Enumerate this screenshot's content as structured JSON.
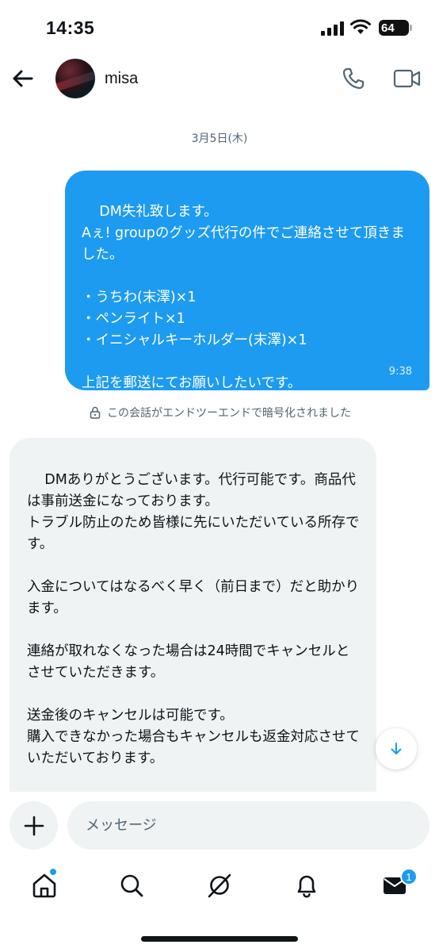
{
  "status_bar": {
    "time": "14:35",
    "battery": "64"
  },
  "header": {
    "contact_name": "misa",
    "icons": [
      "back-arrow-icon",
      "avatar",
      "phone-icon",
      "video-camera-icon"
    ]
  },
  "chat": {
    "date_separator": "3月5日(木)",
    "messages": [
      {
        "direction": "outgoing",
        "text": "DM失礼致します。\nAぇ! groupのグッズ代行の件でご連絡させて頂きました。\n\n・うちわ(末澤)×1\n・ペンライト×1\n・イニシャルキーホルダー(末澤)×1\n\n上記を郵送にてお願いしたいです。",
        "time": "9:38"
      },
      {
        "direction": "incoming",
        "text": "DMありがとうございます。代行可能です。商品代は事前送金になっております。\nトラブル防止のため皆様に先にいただいている所存です。\n\n入金についてはなるべく早く（前日まで）だと助かります。\n\n連絡が取れなくなった場合は24時間でキャンセルとさせていただきます。\n\n送金後のキャンセルは可能です。\n購入できなかった場合もキャンセルも返金対応させていただいております。\n\n長文になりましたがよろしくお願いします"
      }
    ],
    "encryption_note": "この会話がエンドツーエンドで暗号化されました"
  },
  "composer": {
    "placeholder": "メッセージ"
  },
  "bottom_nav": {
    "items": [
      "home-icon",
      "search-icon",
      "grok-icon",
      "notifications-bell-icon",
      "messages-envelope-icon"
    ],
    "messages_badge": "1"
  },
  "colors": {
    "accent": "#1d9bf0",
    "incoming_bubble": "#eff3f4",
    "secondary_text": "#536471"
  }
}
